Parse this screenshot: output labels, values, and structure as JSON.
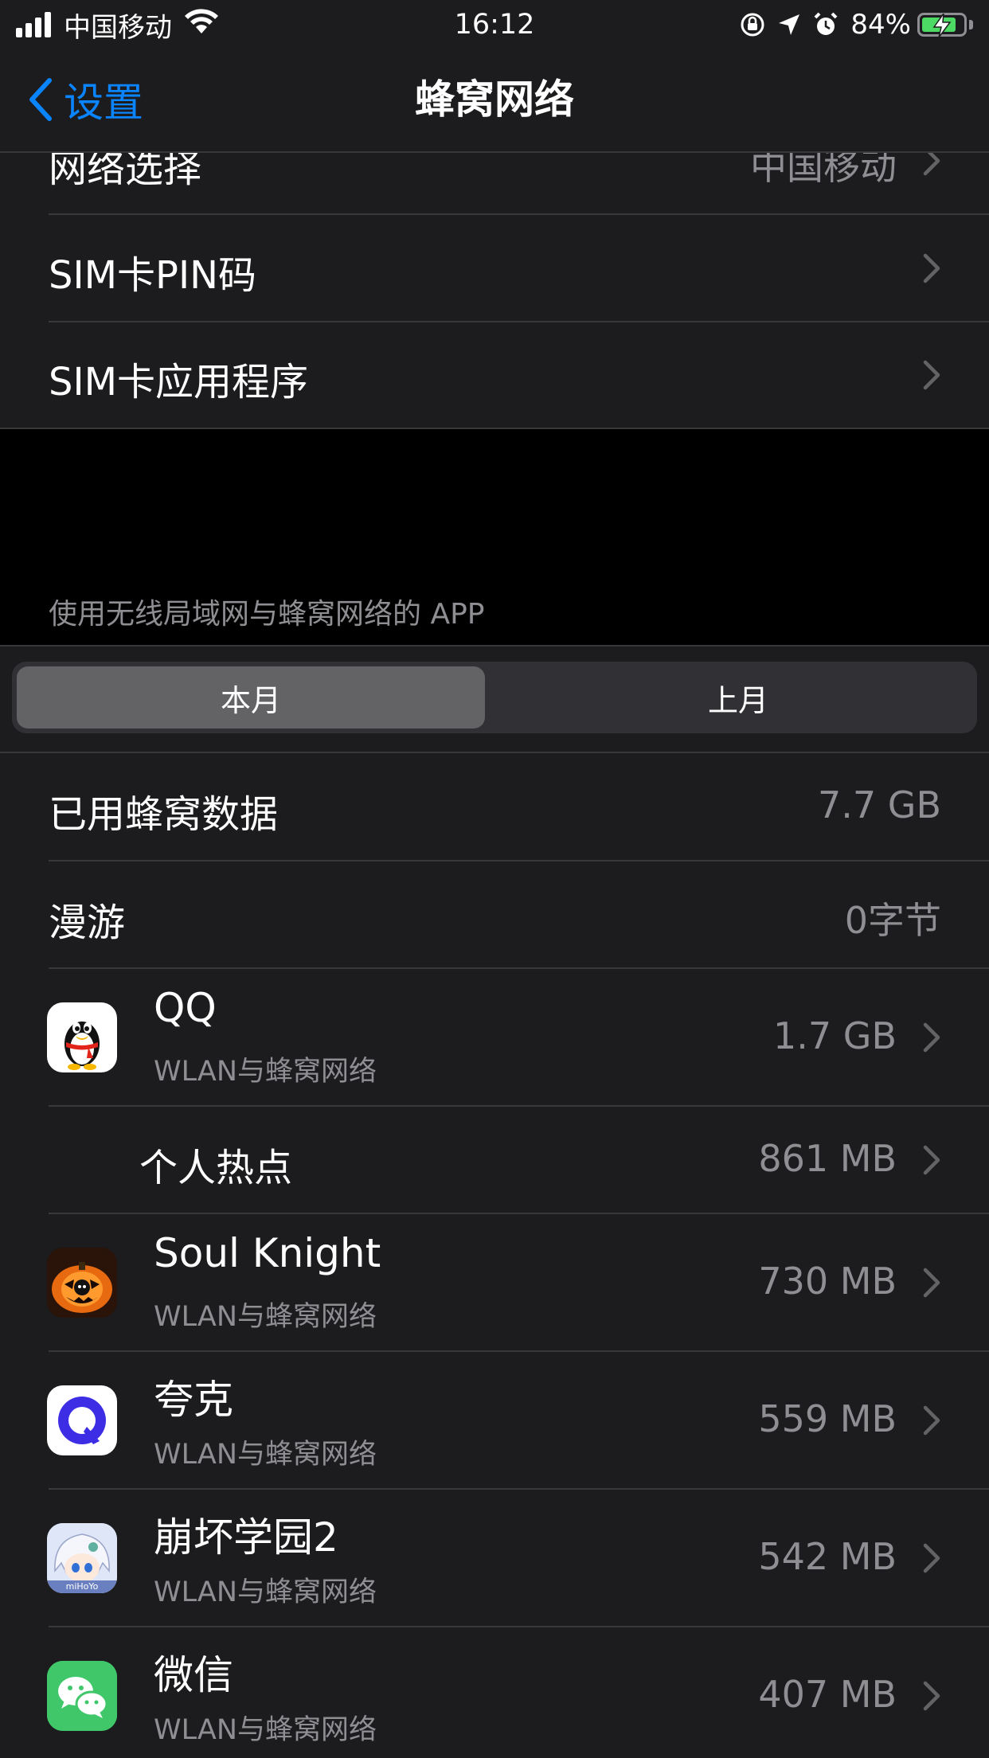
{
  "status_bar": {
    "carrier": "中国移动",
    "time": "16:12",
    "battery_percent": "84%",
    "battery_level": 0.84,
    "icons": [
      "signal-icon",
      "wifi-icon",
      "orientation-lock-icon",
      "location-icon",
      "alarm-icon",
      "battery-charging-icon"
    ]
  },
  "nav": {
    "back_label": "设置",
    "title": "蜂窝网络"
  },
  "settings_rows": [
    {
      "label": "网络选择",
      "value": "中国移动"
    },
    {
      "label": "SIM卡PIN码"
    },
    {
      "label": "SIM卡应用程序"
    }
  ],
  "usage_section": {
    "header": "使用无线局域网与蜂窝网络的 APP",
    "segments": [
      "本月",
      "上月"
    ],
    "selected_segment": "本月"
  },
  "summary_rows": [
    {
      "label": "已用蜂窝数据",
      "value": "7.7 GB"
    },
    {
      "label": "漫游",
      "value": "0字节"
    }
  ],
  "apps": [
    {
      "name": "QQ",
      "subtitle": "WLAN与蜂窝网络",
      "value": "1.7 GB",
      "icon": "qq-penguin-icon"
    },
    {
      "name": "个人热点",
      "value": "861 MB"
    },
    {
      "name": "Soul Knight",
      "subtitle": "WLAN与蜂窝网络",
      "value": "730 MB",
      "icon": "soul-knight-icon"
    },
    {
      "name": "夸克",
      "subtitle": "WLAN与蜂窝网络",
      "value": "559 MB",
      "icon": "quark-icon"
    },
    {
      "name": "崩坏学园2",
      "subtitle": "WLAN与蜂窝网络",
      "value": "542 MB",
      "icon": "honkai-gakuen-icon",
      "icon_text": "miHoYo"
    },
    {
      "name": "微信",
      "subtitle": "WLAN与蜂窝网络",
      "value": "407 MB",
      "icon": "wechat-icon"
    }
  ],
  "colors": {
    "background": "#000000",
    "cell": "#1c1c1e",
    "separator": "#38383a",
    "accent": "#0a84ff",
    "secondary_text": "#8e8e93",
    "battery_green": "#4cd964"
  }
}
